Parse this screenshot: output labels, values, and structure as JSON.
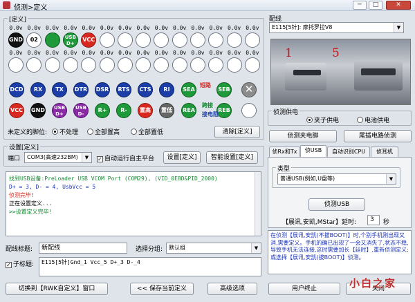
{
  "window": {
    "title": "侦测>定义",
    "min": "─",
    "max": "□",
    "close": "✕"
  },
  "define_group": {
    "label": "[定义]"
  },
  "pins_row1": {
    "voltages": [
      "0.0v",
      "0.0v",
      "0.0v",
      "0.0v",
      "0.0v",
      "0.0v",
      "0.0v",
      "0.0v",
      "0.0v",
      "0.0v",
      "0.0v",
      "0.0v",
      "0.0v",
      "0.0v"
    ],
    "labels": [
      "GND",
      "02",
      "",
      "USB D+",
      "VCC",
      "",
      "",
      "",
      "",
      "",
      "",
      "",
      "",
      ""
    ]
  },
  "pins_row2": {
    "voltages": [
      "0.0v",
      "0.0v",
      "0.0v",
      "0.0v",
      "0.0v",
      "0.0v",
      "0.0v",
      "0.0v",
      "0.0v",
      "0.0v",
      "0.0v",
      "0.0v",
      "0.0v",
      "0.0v"
    ]
  },
  "func_row1": [
    "DCD",
    "RX",
    "TX",
    "DTR",
    "DSR",
    "RTS",
    "CTS",
    "RI",
    "SEA",
    "SEB"
  ],
  "func_row1_extra": "短路",
  "func_row2": [
    "VCC",
    "GND",
    "USB D+",
    "USB D-",
    "R+",
    "R-",
    "置高",
    "置低",
    "REA",
    "REB"
  ],
  "func_row2_extra": "接电阻",
  "func_row2_extra_top": "跨接",
  "x_icon": "✕",
  "undefined_pins": {
    "label": "未定义的脚位:",
    "options": [
      "不处理",
      "全部置高",
      "全部置低"
    ],
    "selected": 0,
    "clear_button": "清除[定义]"
  },
  "settings_group": {
    "label": "设置[定义]",
    "port_label": "端口",
    "port_value": "COM3(高速232BM)",
    "auto_run_label": "自动运行自主平台",
    "auto_run_checked": true,
    "set_button": "设置[定义]",
    "smart_button": "智能设置[定义]"
  },
  "log_lines": [
    "找到USB设备:PreLoader USB VCOM Port (COM29), (VID_0E8D&PID_2000)",
    "D+ = 3, D- = 4, UsbVcc = 5",
    "侦测完毕!",
    "正在设置定义...",
    ">>设置定义完毕!"
  ],
  "name_row": {
    "label": "配线标题:",
    "value": "新配线",
    "group_label": "选择分组:",
    "group_value": "默认组"
  },
  "sub_title": {
    "label": "子标题:",
    "checked": true,
    "value": "E115[5针]Gnd_1  Vcc_5  D+_3  D-_4"
  },
  "bottom_buttons": {
    "switch": "切换到【RWK自定义】窗口",
    "save": "<< 保存当前定义",
    "advanced": "高级选项",
    "stop": "用户终止",
    "close": "关闭"
  },
  "wiring": {
    "label": "配线",
    "value": "E115[5针]: 摩托罗拉V8"
  },
  "photo": {
    "label_left": "1",
    "label_right": "5"
  },
  "power": {
    "label": "侦测供电",
    "options": [
      "夹子供电",
      "电池供电"
    ],
    "selected": 0
  },
  "power_buttons": {
    "detect": "侦测夹电脚",
    "tail": "尾插电路侦测"
  },
  "tabs": [
    "侦Rx和Tx",
    "侦USB",
    "自动识别CPU",
    "侦耳机"
  ],
  "active_tab": 1,
  "type_group": {
    "label": "类型",
    "value": "普通USB(例如,U盘等)"
  },
  "detect_usb_button": "侦测USB",
  "delay": {
    "label": "【展讯,安凯,MStar】延时:",
    "value": "3",
    "unit": "秒"
  },
  "help_text": "在侦测【展讯,安凯(不拔BOOT)】时,个别手机刚出现又消,需要定义。手机的确已出现了一会又消失了,状态不稳,导致手机无法连接,这时需要加长【延时】,重新侦测定义;或选择【展讯,安凯(拔BOOT)】侦测。",
  "watermark": "小白之家",
  "colors": {
    "accent_red": "#d9281f",
    "log_green": "#118a2f",
    "help_blue": "#1e34b4"
  }
}
